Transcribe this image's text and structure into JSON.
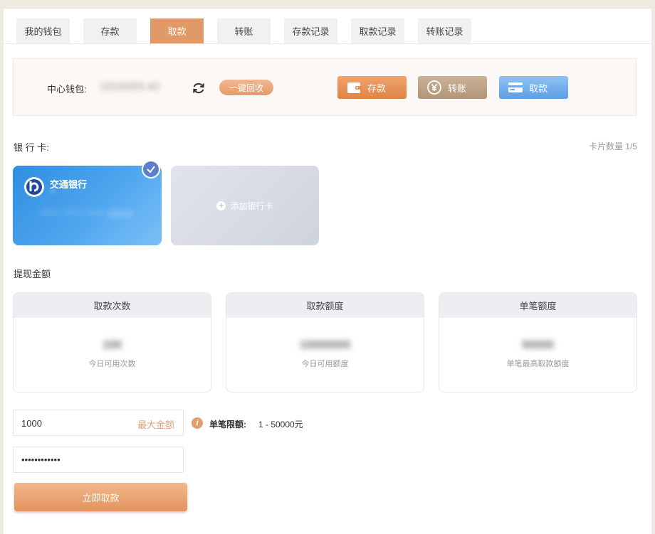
{
  "tabs": [
    {
      "label": "我的钱包",
      "active": false
    },
    {
      "label": "存款",
      "active": false
    },
    {
      "label": "取款",
      "active": true
    },
    {
      "label": "转账",
      "active": false
    },
    {
      "label": "存款记录",
      "active": false
    },
    {
      "label": "取款记录",
      "active": false
    },
    {
      "label": "转账记录",
      "active": false
    }
  ],
  "wallet": {
    "label": "中心钱包:",
    "amount": "1010253.42",
    "recycle_label": "一键回收",
    "deposit_label": "存款",
    "transfer_label": "转账",
    "withdraw_label": "取款"
  },
  "bank_section": {
    "title": "银 行 卡:",
    "card_count": "卡片数量 1/5",
    "card": {
      "bank_name": "交通银行",
      "holder": "**",
      "number": "**** **** **** 0000"
    },
    "add_label": "添加银行卡"
  },
  "withdraw": {
    "title": "提现金额",
    "stats": [
      {
        "header": "取款次数",
        "value": "100",
        "sub": "今日可用次数"
      },
      {
        "header": "取款额度",
        "value": "10000000",
        "sub": "今日可用额度"
      },
      {
        "header": "单笔额度",
        "value": "50000",
        "sub": "单笔最高取款额度"
      }
    ],
    "amount_value": "1000",
    "max_label": "最大金额",
    "limit_label": "单笔限额:",
    "limit_value": "1 - 50000元",
    "password_value": "123456789012",
    "submit_label": "立即取款"
  },
  "colors": {
    "accent": "#e09a67",
    "blue": "#4fa6ee",
    "transfer": "#b39578"
  }
}
